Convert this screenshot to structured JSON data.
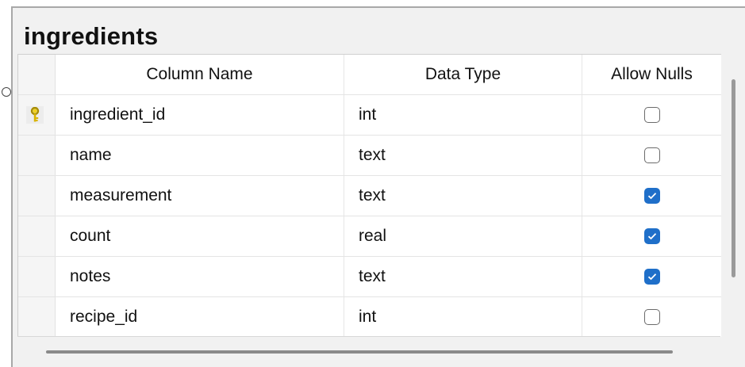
{
  "table": {
    "title": "ingredients",
    "headers": {
      "column_name": "Column Name",
      "data_type": "Data Type",
      "allow_nulls": "Allow Nulls"
    },
    "rows": [
      {
        "name": "ingredient_id",
        "type": "int",
        "allow_nulls": false,
        "primary_key": true
      },
      {
        "name": "name",
        "type": "text",
        "allow_nulls": false,
        "primary_key": false
      },
      {
        "name": "measurement",
        "type": "text",
        "allow_nulls": true,
        "primary_key": false
      },
      {
        "name": "count",
        "type": "real",
        "allow_nulls": true,
        "primary_key": false
      },
      {
        "name": "notes",
        "type": "text",
        "allow_nulls": true,
        "primary_key": false
      },
      {
        "name": "recipe_id",
        "type": "int",
        "allow_nulls": false,
        "primary_key": false
      }
    ]
  },
  "icons": {
    "primary_key": "key-icon",
    "connector": "relationship-connector-icon"
  },
  "colors": {
    "checkbox_checked": "#1f6fc9",
    "key": "#c9a800"
  }
}
